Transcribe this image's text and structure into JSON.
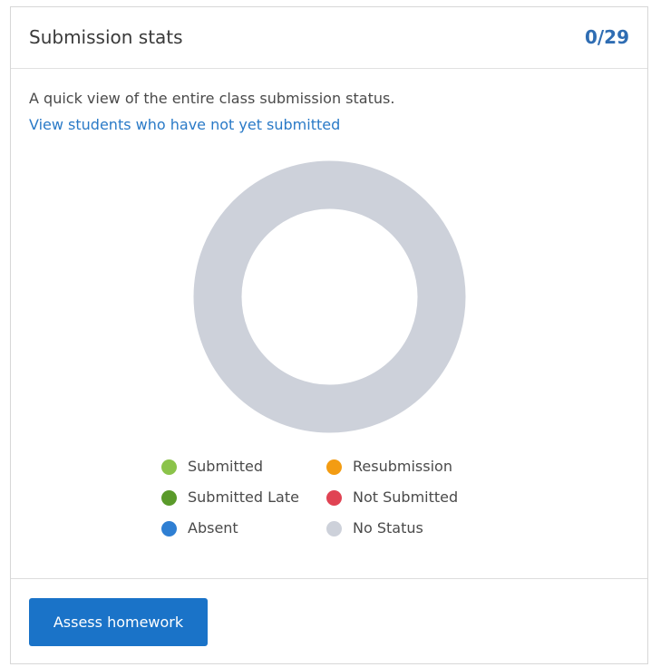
{
  "header": {
    "title": "Submission stats",
    "count": "0/29"
  },
  "body": {
    "description": "A quick view of the entire class submission status.",
    "link_text": "View students who have not yet submitted"
  },
  "legend": [
    {
      "label": "Submitted",
      "color": "#8bc34a"
    },
    {
      "label": "Resubmission",
      "color": "#f39c12"
    },
    {
      "label": "Submitted Late",
      "color": "#5a9a2a"
    },
    {
      "label": "Not Submitted",
      "color": "#e04353"
    },
    {
      "label": "Absent",
      "color": "#2f7fd3"
    },
    {
      "label": "No Status",
      "color": "#cdd1da"
    }
  ],
  "chart_data": {
    "type": "pie",
    "categories": [
      "Submitted",
      "Resubmission",
      "Submitted Late",
      "Not Submitted",
      "Absent",
      "No Status"
    ],
    "values": [
      0,
      0,
      0,
      0,
      0,
      29
    ],
    "colors": [
      "#8bc34a",
      "#f39c12",
      "#5a9a2a",
      "#e04353",
      "#2f7fd3",
      "#cdd1da"
    ],
    "donut": true,
    "legend_position": "bottom"
  },
  "footer": {
    "button_label": "Assess homework"
  }
}
